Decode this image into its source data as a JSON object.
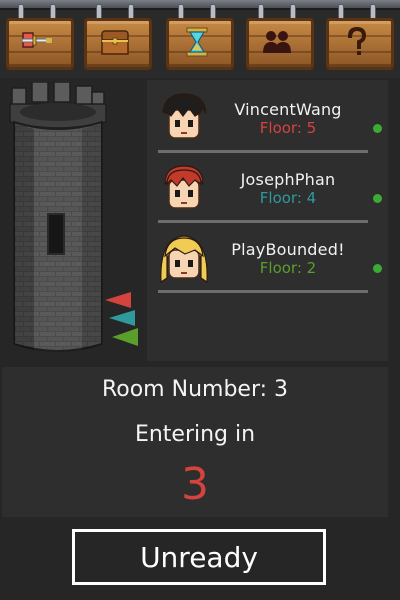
{
  "shop_signs": [
    {
      "icon": "sword-icon"
    },
    {
      "icon": "treasure-chest-icon"
    },
    {
      "icon": "hourglass-icon"
    },
    {
      "icon": "players-icon"
    },
    {
      "icon": "question-mark-icon"
    }
  ],
  "players": [
    {
      "name": "VincentWang",
      "floor": "Floor: 5",
      "floor_color": "#d6433e",
      "hair": "#1e1e1e",
      "ready_color": "#3bab34"
    },
    {
      "name": "JosephPhan",
      "floor": "Floor: 4",
      "floor_color": "#2f9a9c",
      "hair": "#c23a2b",
      "ready_color": "#3bab34"
    },
    {
      "name": "PlayBounded!",
      "floor": "Floor: 2",
      "floor_color": "#5a9e2c",
      "hair": "#f0cc55",
      "ready_color": "#3bab34"
    }
  ],
  "flags": [
    "#d6433e",
    "#2f9a9c",
    "#5a9e2c"
  ],
  "room": {
    "number_label": "Room Number: 3",
    "entering_label": "Entering in",
    "countdown": "3"
  },
  "unready_label": "Unready"
}
